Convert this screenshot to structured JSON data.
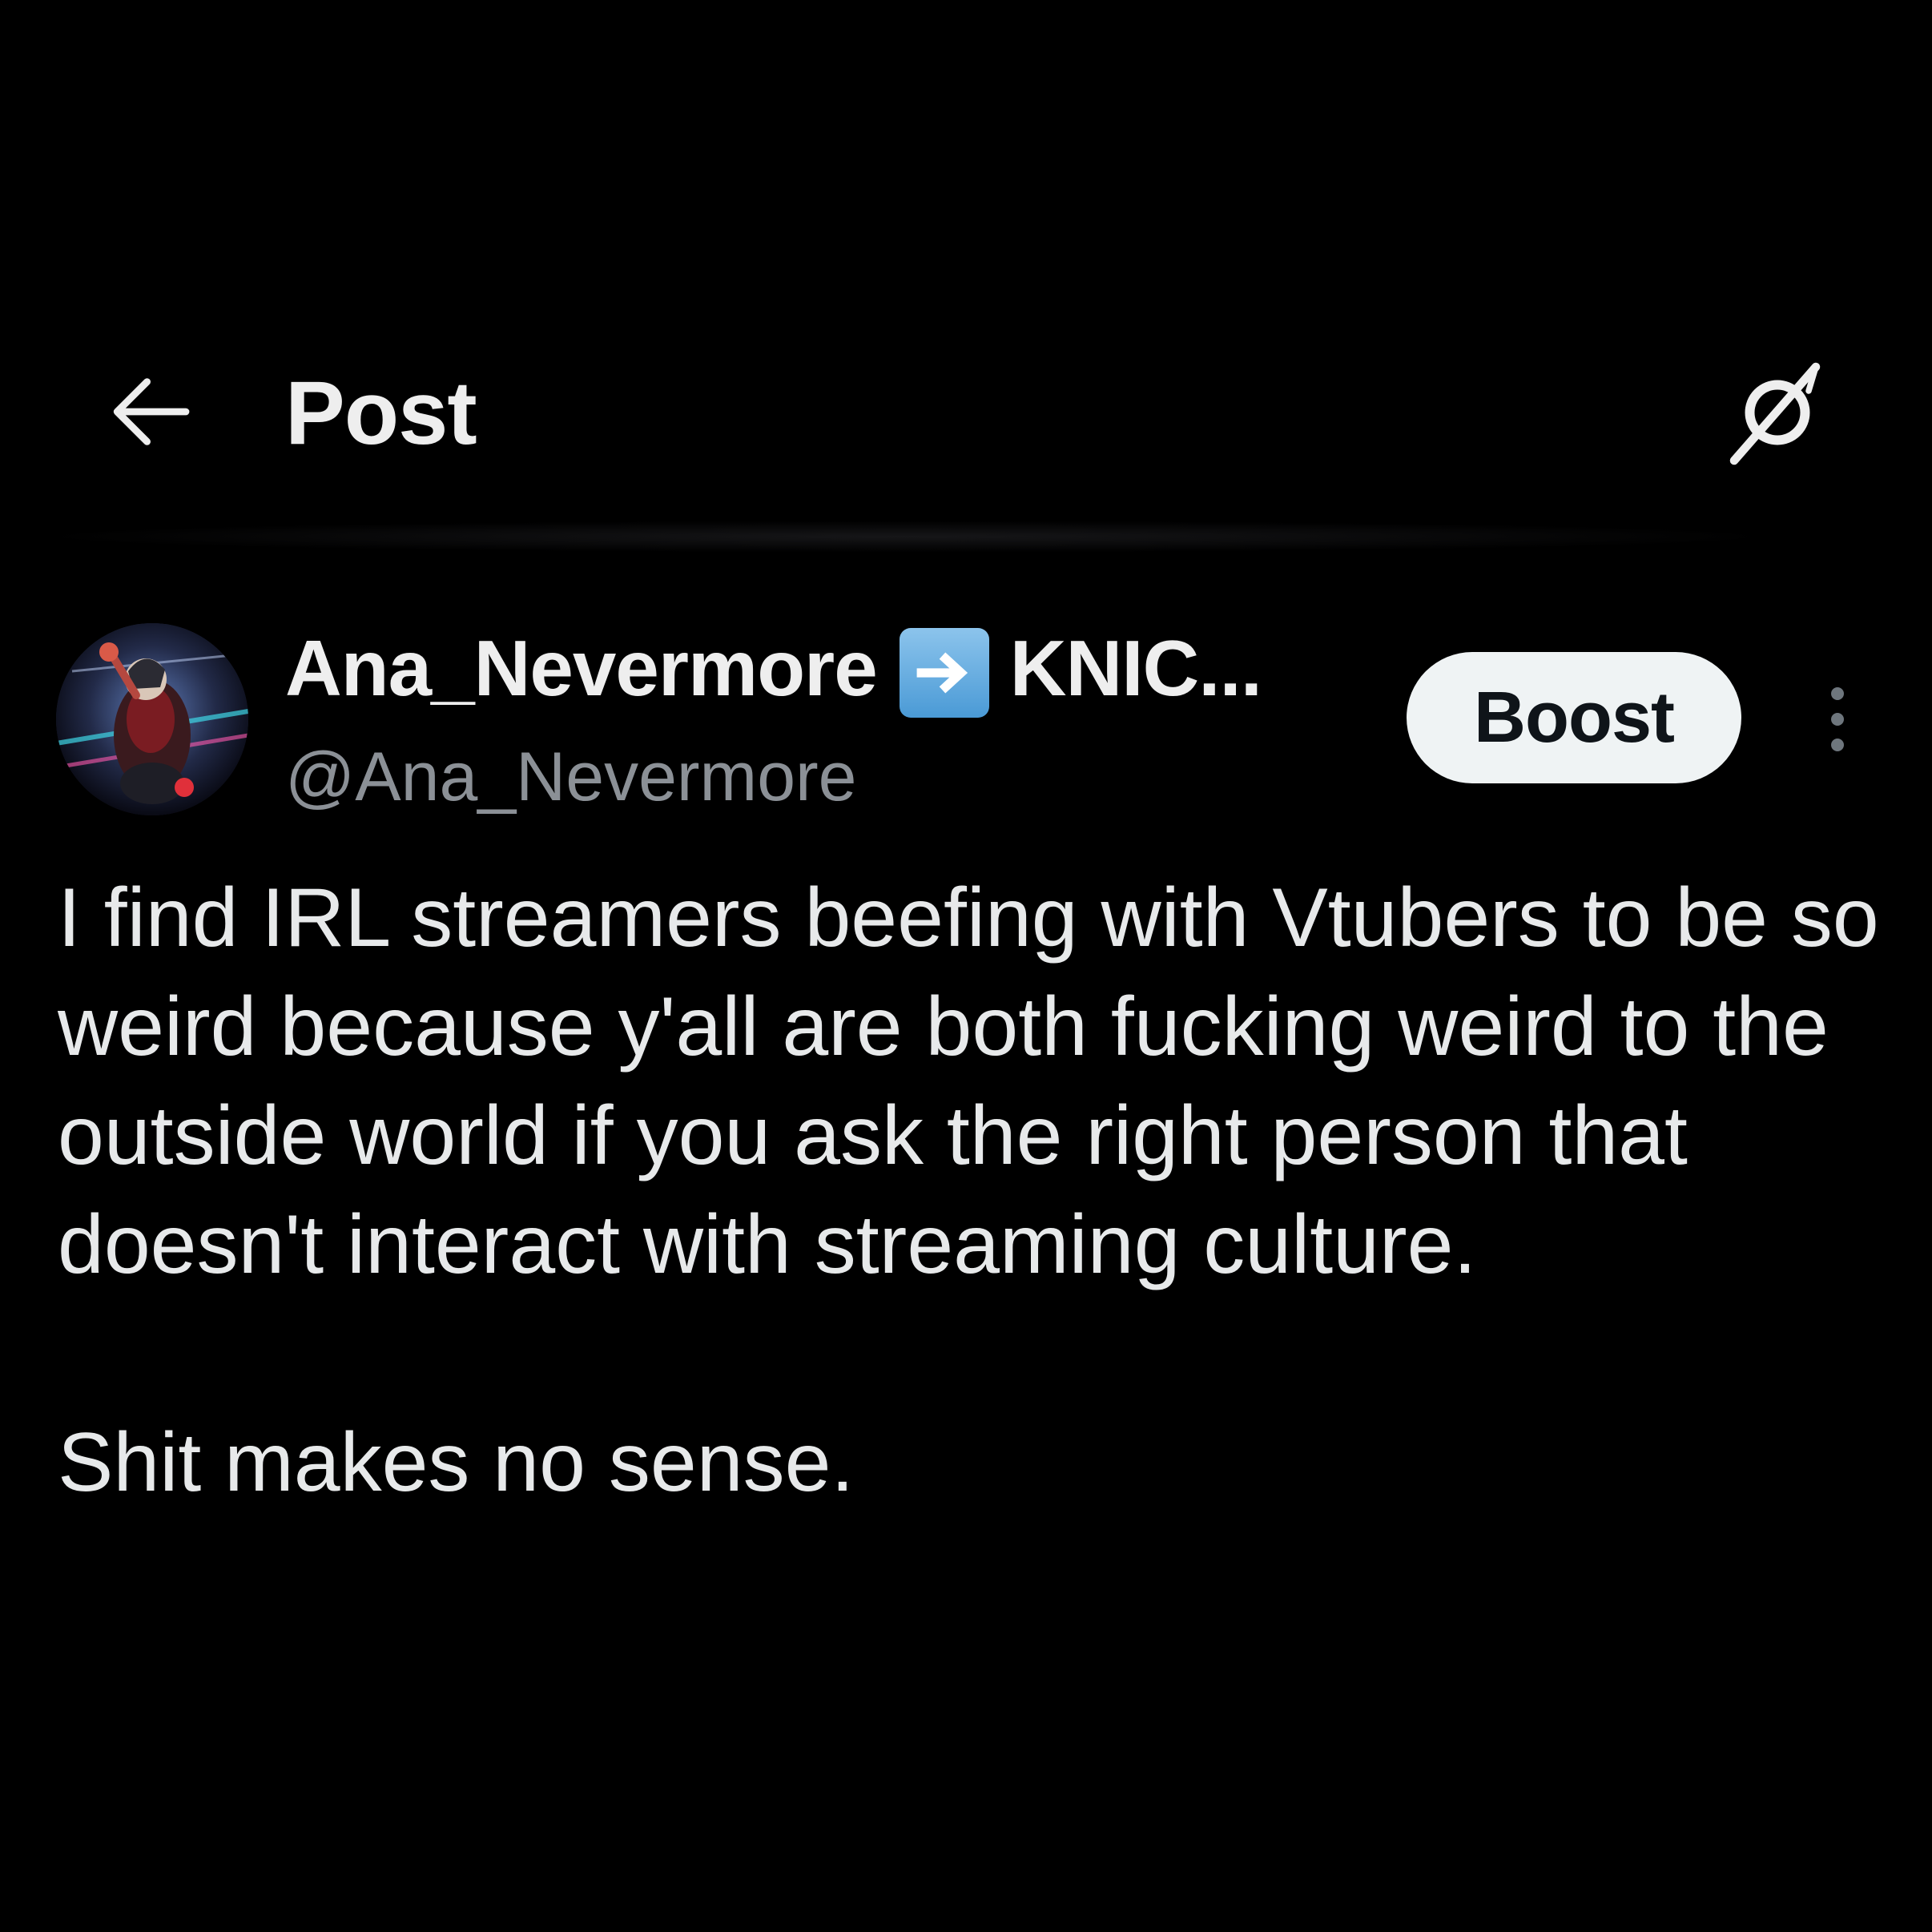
{
  "header": {
    "title": "Post",
    "back_icon": "arrow-left-icon",
    "grok_icon": "grok-icon"
  },
  "post": {
    "author": {
      "display_name": "Ana_Nevermore",
      "name_emoji": "right-arrow-emoji",
      "name_suffix": "KNIC...",
      "handle": "@Ana_Nevermore"
    },
    "boost_label": "Boost",
    "more_icon": "more-vertical-icon",
    "text_paragraphs": [
      "I find IRL streamers beefing with Vtubers to be so weird because y'all are both fucking weird to the outside world if you ask the right person that doesn't interact with streaming culture.",
      "Shit makes no sense."
    ]
  },
  "colors": {
    "background": "#000000",
    "text_primary": "#e7e9ea",
    "text_secondary": "#8b9096",
    "boost_bg": "#eff3f4",
    "boost_text": "#0f1419",
    "emoji_blue": "#5aa6de"
  }
}
